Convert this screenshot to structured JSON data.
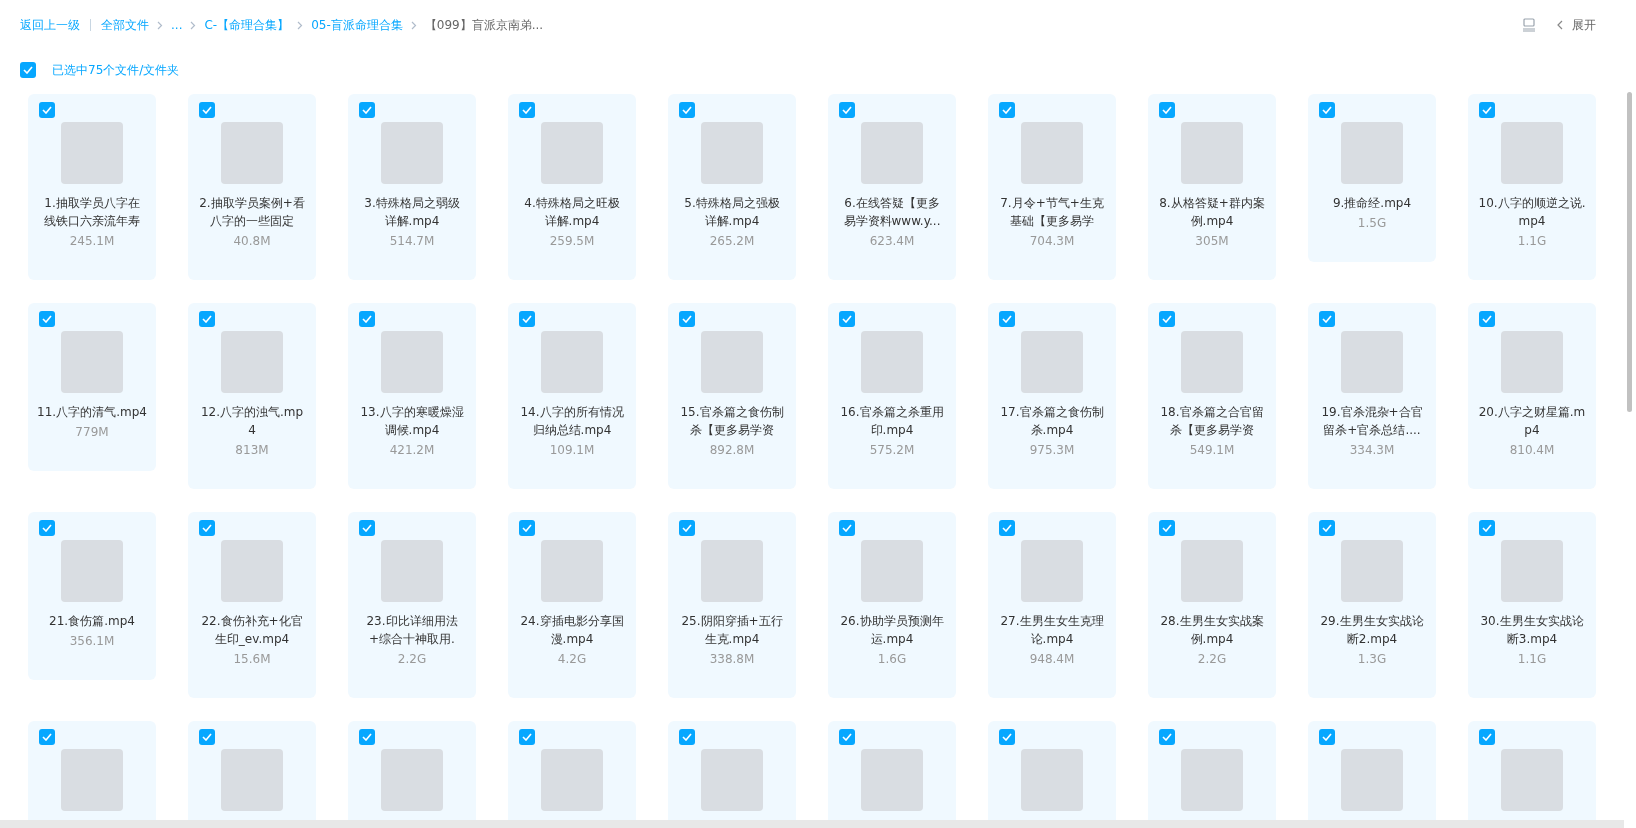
{
  "breadcrumb": {
    "back": "返回上一级",
    "items": [
      {
        "label": "全部文件",
        "current": false
      },
      {
        "label": "...",
        "current": false
      },
      {
        "label": "C-【命理合集】",
        "current": false
      },
      {
        "label": "05-盲派命理合集",
        "current": false
      },
      {
        "label": "【099】盲派京南弟...",
        "current": true
      }
    ]
  },
  "toolbar": {
    "expand": "展开"
  },
  "selection": {
    "checked": true,
    "label": "已选中75个文件/文件夹"
  },
  "files": [
    {
      "name_lines": [
        "1.抽取学员八字在",
        "线铁口六亲流年寿"
      ],
      "size": "245.1M",
      "selected": true
    },
    {
      "name_lines": [
        "2.抽取学员案例+看",
        "八字的一些固定"
      ],
      "size": "40.8M",
      "selected": true
    },
    {
      "name_lines": [
        "3.特殊格局之弱级",
        "详解.mp4"
      ],
      "size": "514.7M",
      "selected": true
    },
    {
      "name_lines": [
        "4.特殊格局之旺极",
        "详解.mp4"
      ],
      "size": "259.5M",
      "selected": true
    },
    {
      "name_lines": [
        "5.特殊格局之强极",
        "详解.mp4"
      ],
      "size": "265.2M",
      "selected": true
    },
    {
      "name_lines": [
        "6.在线答疑【更多",
        "易学资料www.y..."
      ],
      "size": "623.4M",
      "selected": true
    },
    {
      "name_lines": [
        "7.月令+节气+生克",
        "基础【更多易学"
      ],
      "size": "704.3M",
      "selected": true
    },
    {
      "name_lines": [
        "8.从格答疑+群内案",
        "例.mp4"
      ],
      "size": "305M",
      "selected": true
    },
    {
      "name_lines": [
        "9.推命经.mp4"
      ],
      "size": "1.5G",
      "selected": true
    },
    {
      "name_lines": [
        "10.八字的顺逆之说.",
        "mp4"
      ],
      "size": "1.1G",
      "selected": true
    },
    {
      "name_lines": [
        "11.八字的清气.mp4"
      ],
      "size": "779M",
      "selected": true
    },
    {
      "name_lines": [
        "12.八字的浊气.mp",
        "4"
      ],
      "size": "813M",
      "selected": true
    },
    {
      "name_lines": [
        "13.八字的寒暖燥湿",
        "调候.mp4"
      ],
      "size": "421.2M",
      "selected": true
    },
    {
      "name_lines": [
        "14.八字的所有情况",
        "归纳总结.mp4"
      ],
      "size": "109.1M",
      "selected": true
    },
    {
      "name_lines": [
        "15.官杀篇之食伤制",
        "杀【更多易学资"
      ],
      "size": "892.8M",
      "selected": true
    },
    {
      "name_lines": [
        "16.官杀篇之杀重用",
        "印.mp4"
      ],
      "size": "575.2M",
      "selected": true
    },
    {
      "name_lines": [
        "17.官杀篇之食伤制",
        "杀.mp4"
      ],
      "size": "975.3M",
      "selected": true
    },
    {
      "name_lines": [
        "18.官杀篇之合官留",
        "杀【更多易学资"
      ],
      "size": "549.1M",
      "selected": true
    },
    {
      "name_lines": [
        "19.官杀混杂+合官",
        "留杀+官杀总结...."
      ],
      "size": "334.3M",
      "selected": true
    },
    {
      "name_lines": [
        "20.八字之财星篇.m",
        "p4"
      ],
      "size": "810.4M",
      "selected": true
    },
    {
      "name_lines": [
        "21.食伤篇.mp4"
      ],
      "size": "356.1M",
      "selected": true
    },
    {
      "name_lines": [
        "22.食伤补充+化官",
        "生印_ev.mp4"
      ],
      "size": "15.6M",
      "selected": true
    },
    {
      "name_lines": [
        "23.印比详细用法",
        "+综合十神取用."
      ],
      "size": "2.2G",
      "selected": true
    },
    {
      "name_lines": [
        "24.穿插电影分享国",
        "漫.mp4"
      ],
      "size": "4.2G",
      "selected": true
    },
    {
      "name_lines": [
        "25.阴阳穿插+五行",
        "生克.mp4"
      ],
      "size": "338.8M",
      "selected": true
    },
    {
      "name_lines": [
        "26.协助学员预测年",
        "运.mp4"
      ],
      "size": "1.6G",
      "selected": true
    },
    {
      "name_lines": [
        "27.生男生女生克理",
        "论.mp4"
      ],
      "size": "948.4M",
      "selected": true
    },
    {
      "name_lines": [
        "28.生男生女实战案",
        "例.mp4"
      ],
      "size": "2.2G",
      "selected": true
    },
    {
      "name_lines": [
        "29.生男生女实战论",
        "断2.mp4"
      ],
      "size": "1.3G",
      "selected": true
    },
    {
      "name_lines": [
        "30.生男生女实战论",
        "断3.mp4"
      ],
      "size": "1.1G",
      "selected": true
    },
    {
      "selected": true
    },
    {
      "selected": true
    },
    {
      "selected": true
    },
    {
      "selected": true
    },
    {
      "selected": true
    },
    {
      "selected": true
    },
    {
      "selected": true
    },
    {
      "selected": true
    },
    {
      "selected": true
    },
    {
      "selected": true
    }
  ]
}
